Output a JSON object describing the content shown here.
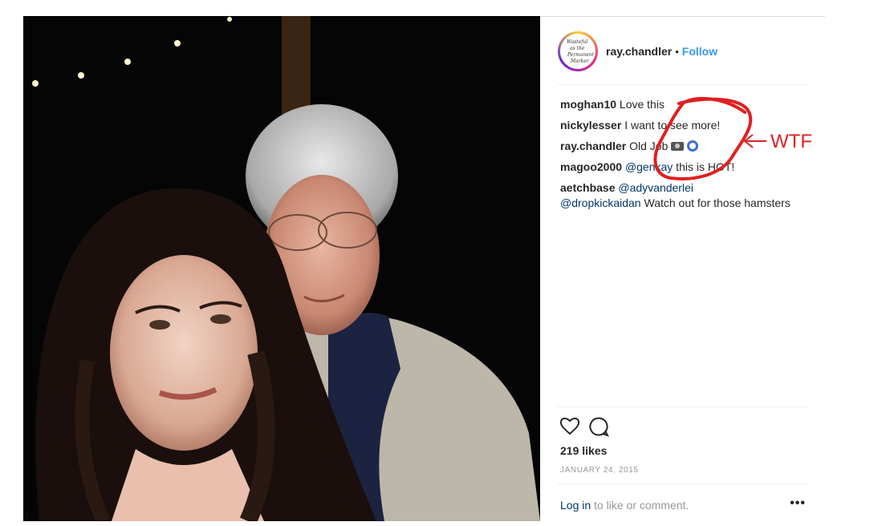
{
  "post": {
    "username": "ray.chandler",
    "separator": "•",
    "follow_label": "Follow",
    "avatar_text": [
      "Wasteful",
      "as the",
      "Permanent",
      "Marker"
    ],
    "comments": [
      {
        "user": "moghan10",
        "text": "Love this",
        "mention": ""
      },
      {
        "user": "nickylesser",
        "text": "I want to see more!",
        "mention": ""
      },
      {
        "user": "ray.chandler",
        "text": "Old Job",
        "mention": "",
        "emoji": [
          "camera",
          "cyclone"
        ]
      },
      {
        "user": "magoo2000",
        "mention": "@genkay",
        "text": " this is HOT!"
      },
      {
        "user": "aetchbase",
        "mention": "@adyvanderlei",
        "mention2": "@dropkickaidan",
        "text": " Watch out for those hamsters"
      }
    ],
    "likes": "219 likes",
    "date": "JANUARY 24, 2015",
    "login_link": "Log in",
    "login_text": " to like or comment.",
    "more_icon": "•••"
  },
  "annotation": {
    "label": "WTF",
    "color": "#e02020"
  },
  "colors": {
    "link": "#3897f0",
    "mention": "#003569",
    "muted": "#999999",
    "text": "#262626"
  }
}
